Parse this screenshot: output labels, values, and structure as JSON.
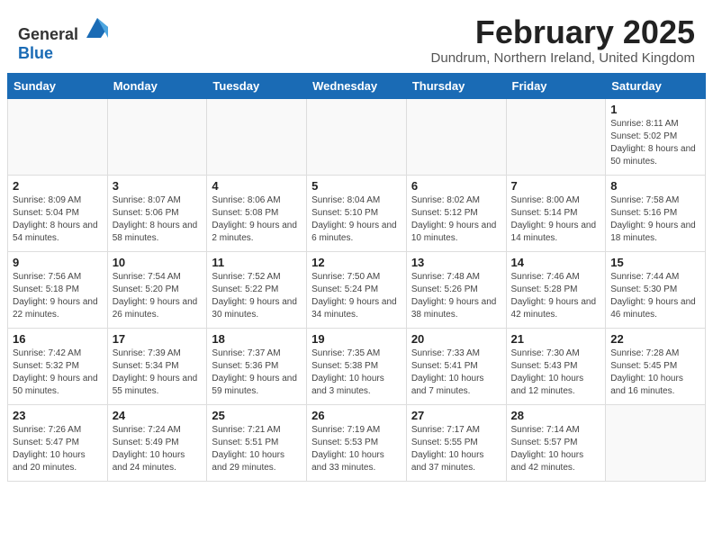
{
  "header": {
    "logo_general": "General",
    "logo_blue": "Blue",
    "title": "February 2025",
    "subtitle": "Dundrum, Northern Ireland, United Kingdom"
  },
  "days_of_week": [
    "Sunday",
    "Monday",
    "Tuesday",
    "Wednesday",
    "Thursday",
    "Friday",
    "Saturday"
  ],
  "weeks": [
    [
      {
        "day": "",
        "info": ""
      },
      {
        "day": "",
        "info": ""
      },
      {
        "day": "",
        "info": ""
      },
      {
        "day": "",
        "info": ""
      },
      {
        "day": "",
        "info": ""
      },
      {
        "day": "",
        "info": ""
      },
      {
        "day": "1",
        "info": "Sunrise: 8:11 AM\nSunset: 5:02 PM\nDaylight: 8 hours and 50 minutes."
      }
    ],
    [
      {
        "day": "2",
        "info": "Sunrise: 8:09 AM\nSunset: 5:04 PM\nDaylight: 8 hours and 54 minutes."
      },
      {
        "day": "3",
        "info": "Sunrise: 8:07 AM\nSunset: 5:06 PM\nDaylight: 8 hours and 58 minutes."
      },
      {
        "day": "4",
        "info": "Sunrise: 8:06 AM\nSunset: 5:08 PM\nDaylight: 9 hours and 2 minutes."
      },
      {
        "day": "5",
        "info": "Sunrise: 8:04 AM\nSunset: 5:10 PM\nDaylight: 9 hours and 6 minutes."
      },
      {
        "day": "6",
        "info": "Sunrise: 8:02 AM\nSunset: 5:12 PM\nDaylight: 9 hours and 10 minutes."
      },
      {
        "day": "7",
        "info": "Sunrise: 8:00 AM\nSunset: 5:14 PM\nDaylight: 9 hours and 14 minutes."
      },
      {
        "day": "8",
        "info": "Sunrise: 7:58 AM\nSunset: 5:16 PM\nDaylight: 9 hours and 18 minutes."
      }
    ],
    [
      {
        "day": "9",
        "info": "Sunrise: 7:56 AM\nSunset: 5:18 PM\nDaylight: 9 hours and 22 minutes."
      },
      {
        "day": "10",
        "info": "Sunrise: 7:54 AM\nSunset: 5:20 PM\nDaylight: 9 hours and 26 minutes."
      },
      {
        "day": "11",
        "info": "Sunrise: 7:52 AM\nSunset: 5:22 PM\nDaylight: 9 hours and 30 minutes."
      },
      {
        "day": "12",
        "info": "Sunrise: 7:50 AM\nSunset: 5:24 PM\nDaylight: 9 hours and 34 minutes."
      },
      {
        "day": "13",
        "info": "Sunrise: 7:48 AM\nSunset: 5:26 PM\nDaylight: 9 hours and 38 minutes."
      },
      {
        "day": "14",
        "info": "Sunrise: 7:46 AM\nSunset: 5:28 PM\nDaylight: 9 hours and 42 minutes."
      },
      {
        "day": "15",
        "info": "Sunrise: 7:44 AM\nSunset: 5:30 PM\nDaylight: 9 hours and 46 minutes."
      }
    ],
    [
      {
        "day": "16",
        "info": "Sunrise: 7:42 AM\nSunset: 5:32 PM\nDaylight: 9 hours and 50 minutes."
      },
      {
        "day": "17",
        "info": "Sunrise: 7:39 AM\nSunset: 5:34 PM\nDaylight: 9 hours and 55 minutes."
      },
      {
        "day": "18",
        "info": "Sunrise: 7:37 AM\nSunset: 5:36 PM\nDaylight: 9 hours and 59 minutes."
      },
      {
        "day": "19",
        "info": "Sunrise: 7:35 AM\nSunset: 5:38 PM\nDaylight: 10 hours and 3 minutes."
      },
      {
        "day": "20",
        "info": "Sunrise: 7:33 AM\nSunset: 5:41 PM\nDaylight: 10 hours and 7 minutes."
      },
      {
        "day": "21",
        "info": "Sunrise: 7:30 AM\nSunset: 5:43 PM\nDaylight: 10 hours and 12 minutes."
      },
      {
        "day": "22",
        "info": "Sunrise: 7:28 AM\nSunset: 5:45 PM\nDaylight: 10 hours and 16 minutes."
      }
    ],
    [
      {
        "day": "23",
        "info": "Sunrise: 7:26 AM\nSunset: 5:47 PM\nDaylight: 10 hours and 20 minutes."
      },
      {
        "day": "24",
        "info": "Sunrise: 7:24 AM\nSunset: 5:49 PM\nDaylight: 10 hours and 24 minutes."
      },
      {
        "day": "25",
        "info": "Sunrise: 7:21 AM\nSunset: 5:51 PM\nDaylight: 10 hours and 29 minutes."
      },
      {
        "day": "26",
        "info": "Sunrise: 7:19 AM\nSunset: 5:53 PM\nDaylight: 10 hours and 33 minutes."
      },
      {
        "day": "27",
        "info": "Sunrise: 7:17 AM\nSunset: 5:55 PM\nDaylight: 10 hours and 37 minutes."
      },
      {
        "day": "28",
        "info": "Sunrise: 7:14 AM\nSunset: 5:57 PM\nDaylight: 10 hours and 42 minutes."
      },
      {
        "day": "",
        "info": ""
      }
    ]
  ]
}
